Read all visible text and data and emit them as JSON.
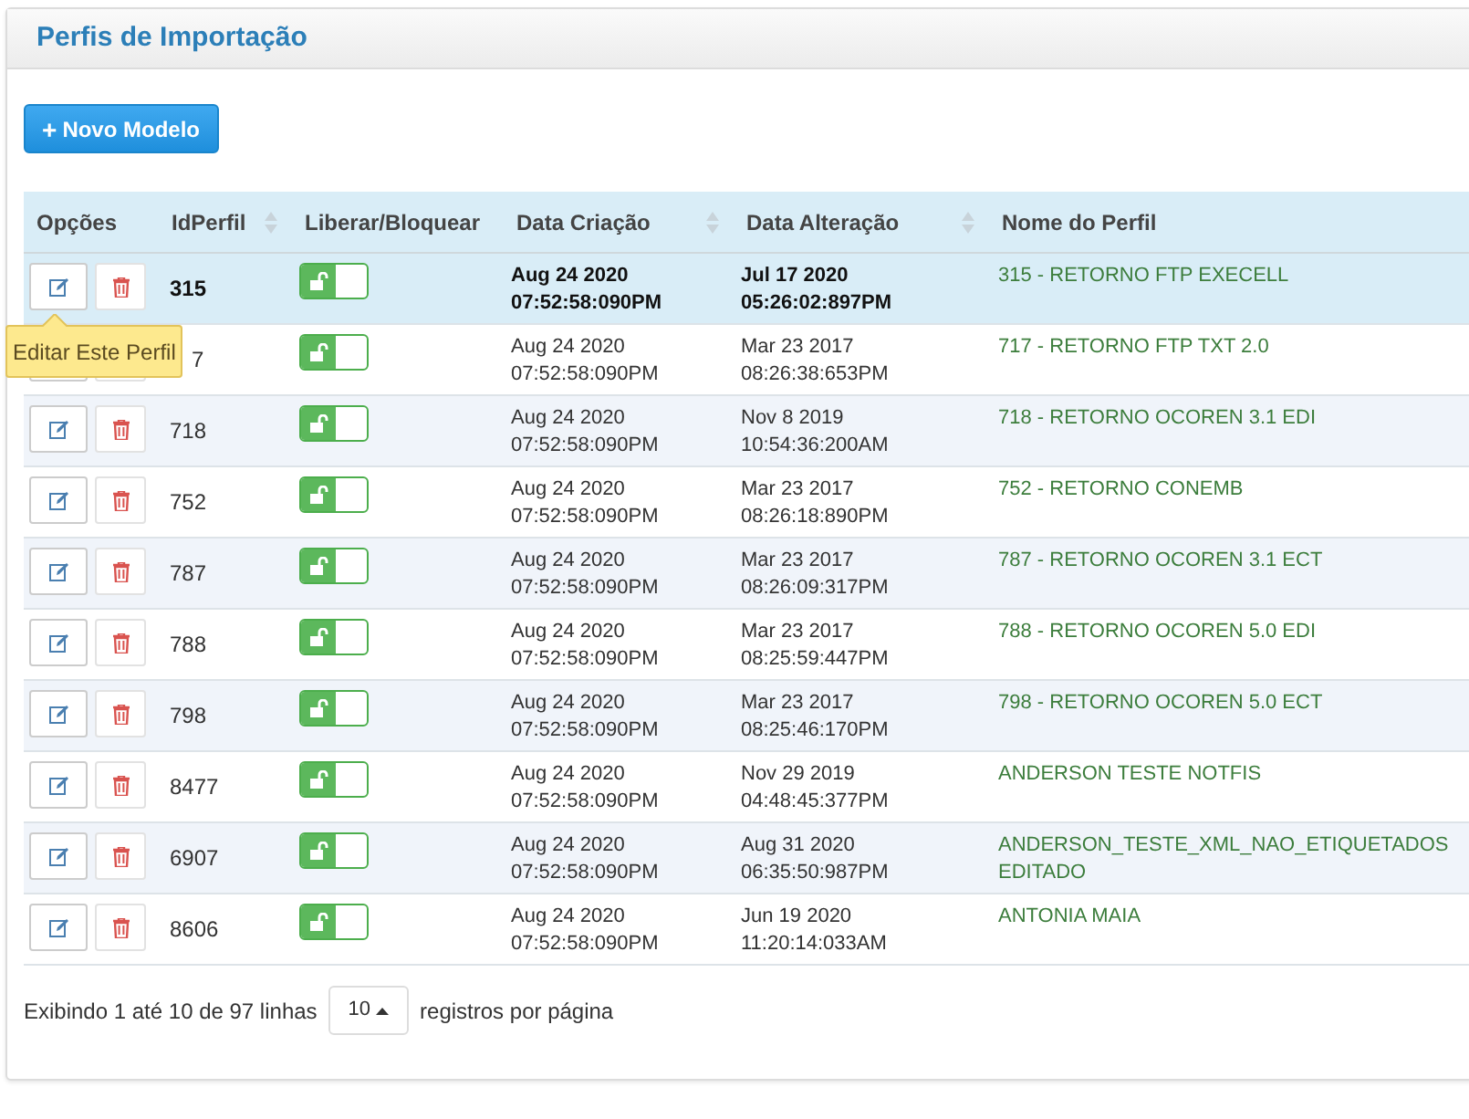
{
  "panel": {
    "title": "Perfis de Importação"
  },
  "new_button": {
    "icon": "+",
    "label": "Novo Modelo"
  },
  "table": {
    "columns": [
      {
        "label": "Opções",
        "sortable": false
      },
      {
        "label": "IdPerfil",
        "sortable": true
      },
      {
        "label": "Liberar/Bloquear",
        "sortable": false
      },
      {
        "label": "Data Criação",
        "sortable": true
      },
      {
        "label": "Data Alteração",
        "sortable": true
      },
      {
        "label": "Nome do Perfil",
        "sortable": false
      }
    ],
    "rows": [
      {
        "id": "315",
        "enabled": true,
        "created": [
          "Aug 24 2020",
          "07:52:58:090PM"
        ],
        "modified": [
          "Jul 17 2020",
          "05:26:02:897PM"
        ],
        "name": "315 - RETORNO FTP EXECELL",
        "selected": true,
        "tooltip": "Editar Este Perfil"
      },
      {
        "id": "7",
        "enabled": true,
        "created": [
          "Aug 24 2020",
          "07:52:58:090PM"
        ],
        "modified": [
          "Mar 23 2017",
          "08:26:38:653PM"
        ],
        "name": "717 - RETORNO FTP TXT 2.0",
        "selected": false
      },
      {
        "id": "718",
        "enabled": true,
        "created": [
          "Aug 24 2020",
          "07:52:58:090PM"
        ],
        "modified": [
          "Nov 8 2019",
          "10:54:36:200AM"
        ],
        "name": "718 - RETORNO OCOREN 3.1 EDI",
        "selected": false
      },
      {
        "id": "752",
        "enabled": true,
        "created": [
          "Aug 24 2020",
          "07:52:58:090PM"
        ],
        "modified": [
          "Mar 23 2017",
          "08:26:18:890PM"
        ],
        "name": "752 - RETORNO CONEMB",
        "selected": false
      },
      {
        "id": "787",
        "enabled": true,
        "created": [
          "Aug 24 2020",
          "07:52:58:090PM"
        ],
        "modified": [
          "Mar 23 2017",
          "08:26:09:317PM"
        ],
        "name": "787 - RETORNO OCOREN 3.1 ECT",
        "selected": false
      },
      {
        "id": "788",
        "enabled": true,
        "created": [
          "Aug 24 2020",
          "07:52:58:090PM"
        ],
        "modified": [
          "Mar 23 2017",
          "08:25:59:447PM"
        ],
        "name": "788 - RETORNO OCOREN 5.0 EDI",
        "selected": false
      },
      {
        "id": "798",
        "enabled": true,
        "created": [
          "Aug 24 2020",
          "07:52:58:090PM"
        ],
        "modified": [
          "Mar 23 2017",
          "08:25:46:170PM"
        ],
        "name": "798 - RETORNO OCOREN 5.0 ECT",
        "selected": false
      },
      {
        "id": "8477",
        "enabled": true,
        "created": [
          "Aug 24 2020",
          "07:52:58:090PM"
        ],
        "modified": [
          "Nov 29 2019",
          "04:48:45:377PM"
        ],
        "name": "ANDERSON TESTE NOTFIS",
        "selected": false
      },
      {
        "id": "6907",
        "enabled": true,
        "created": [
          "Aug 24 2020",
          "07:52:58:090PM"
        ],
        "modified": [
          "Aug 31 2020",
          "06:35:50:987PM"
        ],
        "name": "ANDERSON_TESTE_XML_NAO_ETIQUETADOS EDITADO",
        "selected": false
      },
      {
        "id": "8606",
        "enabled": true,
        "created": [
          "Aug 24 2020",
          "07:52:58:090PM"
        ],
        "modified": [
          "Jun 19 2020",
          "11:20:14:033AM"
        ],
        "name": "ANTONIA MAIA",
        "selected": false
      }
    ]
  },
  "pagination": {
    "before": "Exibindo 1 até 10 de 97 linhas",
    "page_size": "10",
    "after": "registros por página"
  }
}
